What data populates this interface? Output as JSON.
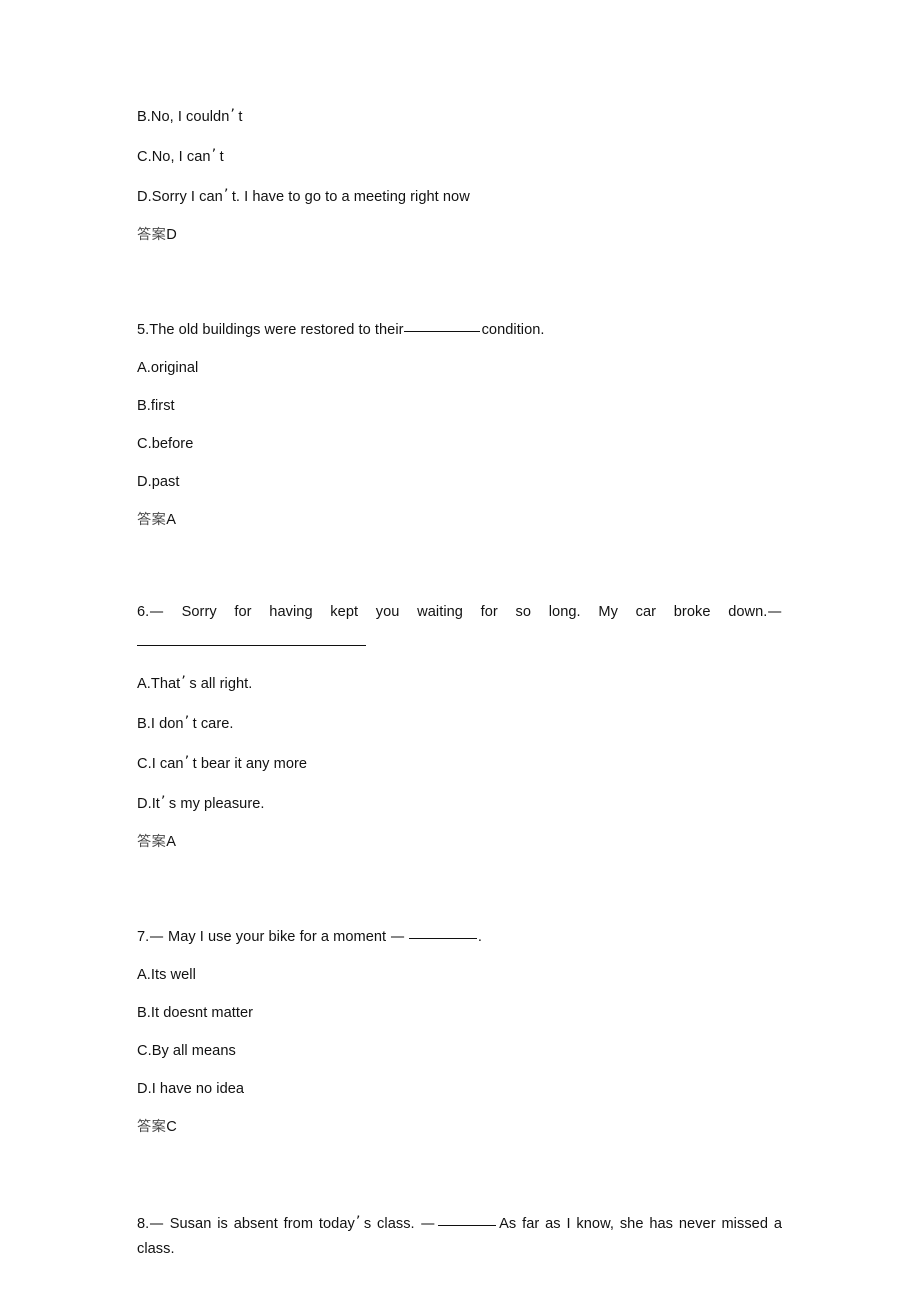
{
  "document": {
    "type": "english-exam-worksheet",
    "answer_label": "答案",
    "blank_marker": "________",
    "dash": "—",
    "apostrophe": "’"
  },
  "questions": [
    {
      "id": "q4-tail",
      "number": "",
      "options": [
        {
          "key": "B",
          "text_before": "B.No, I couldn",
          "text_after": "t"
        },
        {
          "key": "C",
          "text_before": "C.No, I can",
          "text_after": "t"
        },
        {
          "key": "D",
          "text_before": "D.Sorry I can",
          "text_after": "t. I have to go to a meeting right now"
        }
      ],
      "answer": "D"
    },
    {
      "id": "q5",
      "stem_part1": "5.The old buildings were restored to their",
      "stem_part2": "condition.",
      "options": [
        {
          "key": "A",
          "text": "A.original"
        },
        {
          "key": "B",
          "text": "B.first"
        },
        {
          "key": "C",
          "text": "C.before"
        },
        {
          "key": "D",
          "text": "D.past"
        }
      ],
      "answer": "A"
    },
    {
      "id": "q6",
      "stem_line1_number": "6.",
      "stem_line1_text": "Sorry for having kept you waiting for so long. My car broke down.",
      "options": [
        {
          "key": "A",
          "text_before": "A.That",
          "text_after": "s all right."
        },
        {
          "key": "B",
          "text_before": "B.I don",
          "text_after": "t care."
        },
        {
          "key": "C",
          "text_before": "C.I can",
          "text_after": "t bear it any more"
        },
        {
          "key": "D",
          "text_before": "D.It",
          "text_after": "s my pleasure."
        }
      ],
      "answer": "A"
    },
    {
      "id": "q7",
      "stem_number": "7.",
      "stem_text_before": "May I use your bike for a moment",
      "stem_text_after": ".",
      "options": [
        {
          "key": "A",
          "text": "A.Its well"
        },
        {
          "key": "B",
          "text": "B.It doesnt matter"
        },
        {
          "key": "C",
          "text": "C.By all means"
        },
        {
          "key": "D",
          "text": "D.I have no idea"
        }
      ],
      "answer": "C"
    },
    {
      "id": "q8",
      "stem_number": "8.",
      "stem_text_a": "Susan is absent from today",
      "stem_text_b": "s class.",
      "stem_text_c": "As far as I know, she has never missed a class."
    }
  ]
}
